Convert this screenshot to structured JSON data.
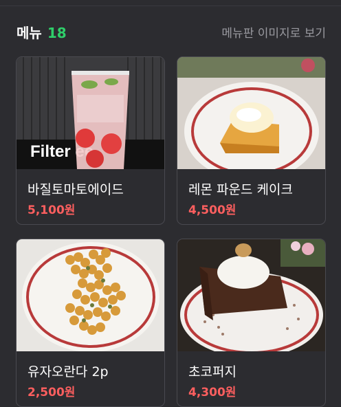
{
  "header": {
    "menu_label": "메뉴",
    "menu_count": "18",
    "view_menu_image": "메뉴판 이미지로 보기"
  },
  "items": [
    {
      "name": "바질토마토에이드",
      "price": "5,100원",
      "photo_sign_text": "Filter   ee",
      "photo_icon": "drink-photo"
    },
    {
      "name": "레몬 파운드 케이크",
      "price": "4,500원",
      "photo_icon": "cake-photo"
    },
    {
      "name": "유자오란다 2p",
      "price": "2,500원",
      "photo_icon": "snack-photo"
    },
    {
      "name": "초코퍼지",
      "price": "4,300원",
      "photo_icon": "fudge-photo"
    }
  ],
  "colors": {
    "accent_green": "#2fcf6a",
    "price_red": "#ff5f5f",
    "background": "#2c2c30"
  }
}
